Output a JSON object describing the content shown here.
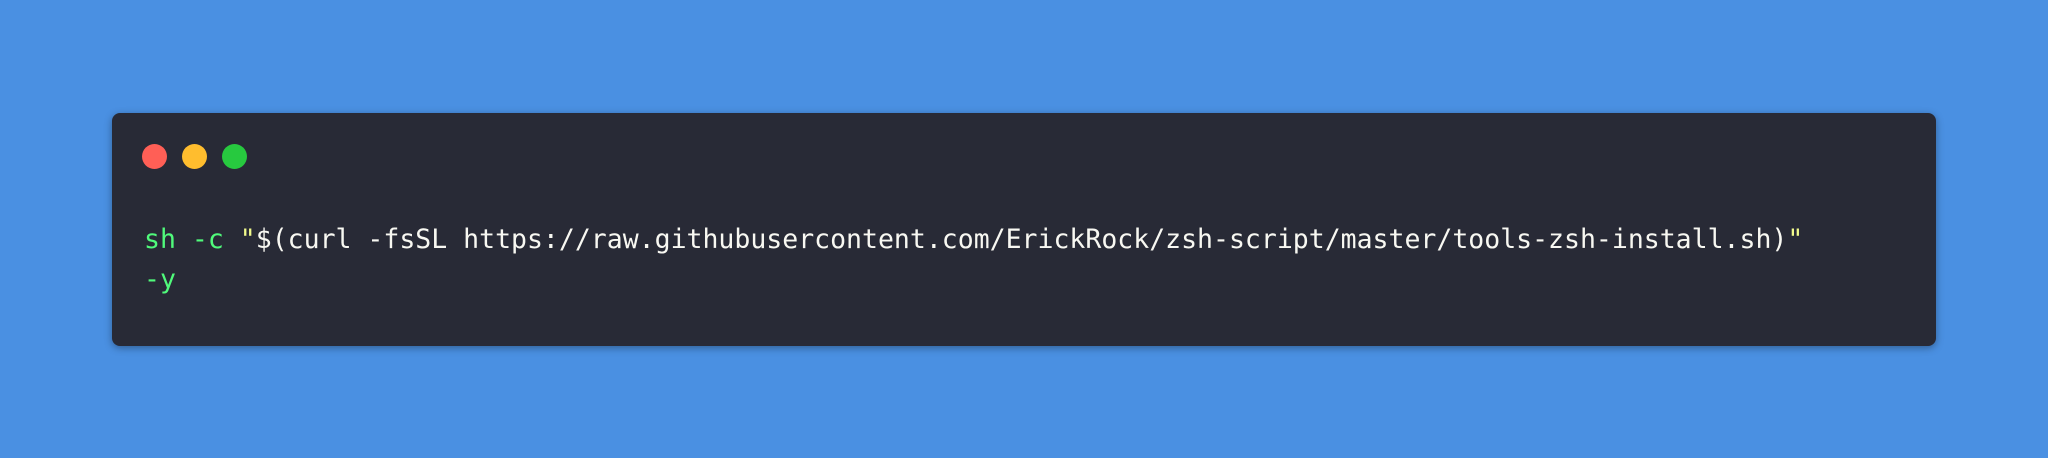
{
  "colors": {
    "background": "#4a90e2",
    "window_background": "#282a36",
    "close_dot": "#ff5f56",
    "minimize_dot": "#ffbd2e",
    "maximize_dot": "#27c93f",
    "command_text": "#50fa7b",
    "plain_text": "#f8f8f2",
    "string_quote": "#f1fa8c"
  },
  "window": {
    "controls": [
      {
        "name": "close",
        "icon": "red-circle"
      },
      {
        "name": "minimize",
        "icon": "yellow-circle"
      },
      {
        "name": "maximize",
        "icon": "green-circle"
      }
    ]
  },
  "code": {
    "line1": {
      "command": "sh",
      "flag": "-c",
      "open_quote": "\"",
      "body": "$(curl -fsSL https://raw.githubusercontent.com/ErickRock/zsh-script/master/tools-zsh-install.sh)",
      "close_quote": "\""
    },
    "line2": {
      "flag": "-y"
    }
  }
}
